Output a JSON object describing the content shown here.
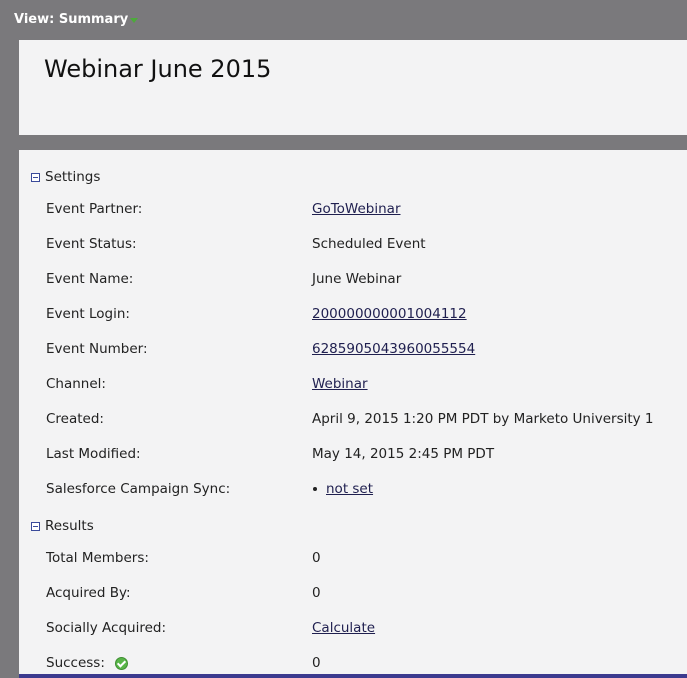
{
  "toolbar": {
    "view_label": "View: Summary"
  },
  "header": {
    "title": "Webinar June 2015"
  },
  "settings": {
    "section_label": "Settings",
    "rows": [
      {
        "label": "Event Partner:",
        "value": "GoToWebinar"
      },
      {
        "label": "Event Status:",
        "value": "Scheduled Event"
      },
      {
        "label": "Event Name:",
        "value": "June Webinar"
      },
      {
        "label": "Event Login:",
        "value": "200000000001004112"
      },
      {
        "label": "Event Number:",
        "value": "6285905043960055554"
      },
      {
        "label": "Channel:",
        "value": "Webinar"
      },
      {
        "label": "Created:",
        "value": "April 9, 2015 1:20 PM PDT by Marketo University 1"
      },
      {
        "label": "Last Modified:",
        "value": "May 14, 2015 2:45 PM PDT"
      },
      {
        "label": "Salesforce Campaign Sync:",
        "value": "not set"
      }
    ]
  },
  "results": {
    "section_label": "Results",
    "rows": [
      {
        "label": "Total Members:",
        "value": "0"
      },
      {
        "label": "Acquired By:",
        "value": "0"
      },
      {
        "label": "Socially Acquired:",
        "value": "Calculate"
      },
      {
        "label": "Success:",
        "value": "0"
      }
    ]
  },
  "icons": {
    "view_dropdown": "chevron-down-icon",
    "collapse": "collapse-minus-icon",
    "success": "check-circle-icon"
  },
  "colors": {
    "toolbar_bg": "#7a797c",
    "panel_bg": "#f3f3f4",
    "link": "#1f1f4f",
    "accent_green": "#58b548",
    "bottom_border": "#3b3a8e"
  }
}
